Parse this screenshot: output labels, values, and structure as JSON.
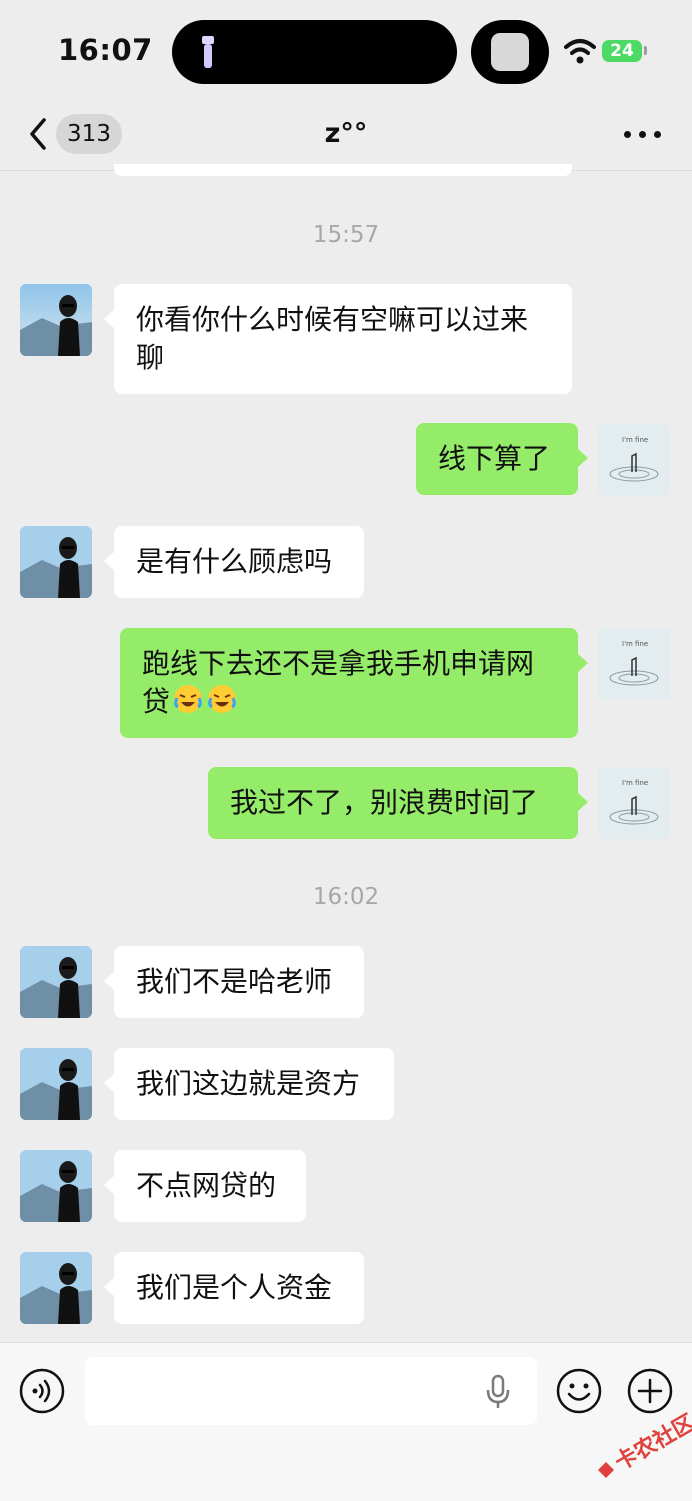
{
  "status_bar": {
    "time": "16:07",
    "battery": "24"
  },
  "nav": {
    "unread_count": "313",
    "title": "z°°"
  },
  "timestamps": [
    "15:57",
    "16:02"
  ],
  "messages": [
    {
      "side": "left",
      "text": "你看你什么时候有空嘛可以过来聊"
    },
    {
      "side": "right",
      "text": "线下算了"
    },
    {
      "side": "left",
      "text": "是有什么顾虑吗"
    },
    {
      "side": "right",
      "text": "跑线下去还不是拿我手机申请网贷"
    },
    {
      "side": "right",
      "text": "我过不了，别浪费时间了"
    },
    {
      "side": "left",
      "text": "我们不是哈老师"
    },
    {
      "side": "left",
      "text": "我们这边就是资方"
    },
    {
      "side": "left",
      "text": "不点网贷的"
    },
    {
      "side": "left",
      "text": "我们是个人资金"
    }
  ],
  "colors": {
    "sent_bubble": "#95ec69",
    "received_bubble": "#ffffff",
    "background": "#ededed"
  },
  "icons": [
    "back-chevron-icon",
    "more-icon",
    "voice-icon",
    "mic-icon",
    "emoji-icon",
    "plus-icon"
  ],
  "watermark": "卡农社区"
}
